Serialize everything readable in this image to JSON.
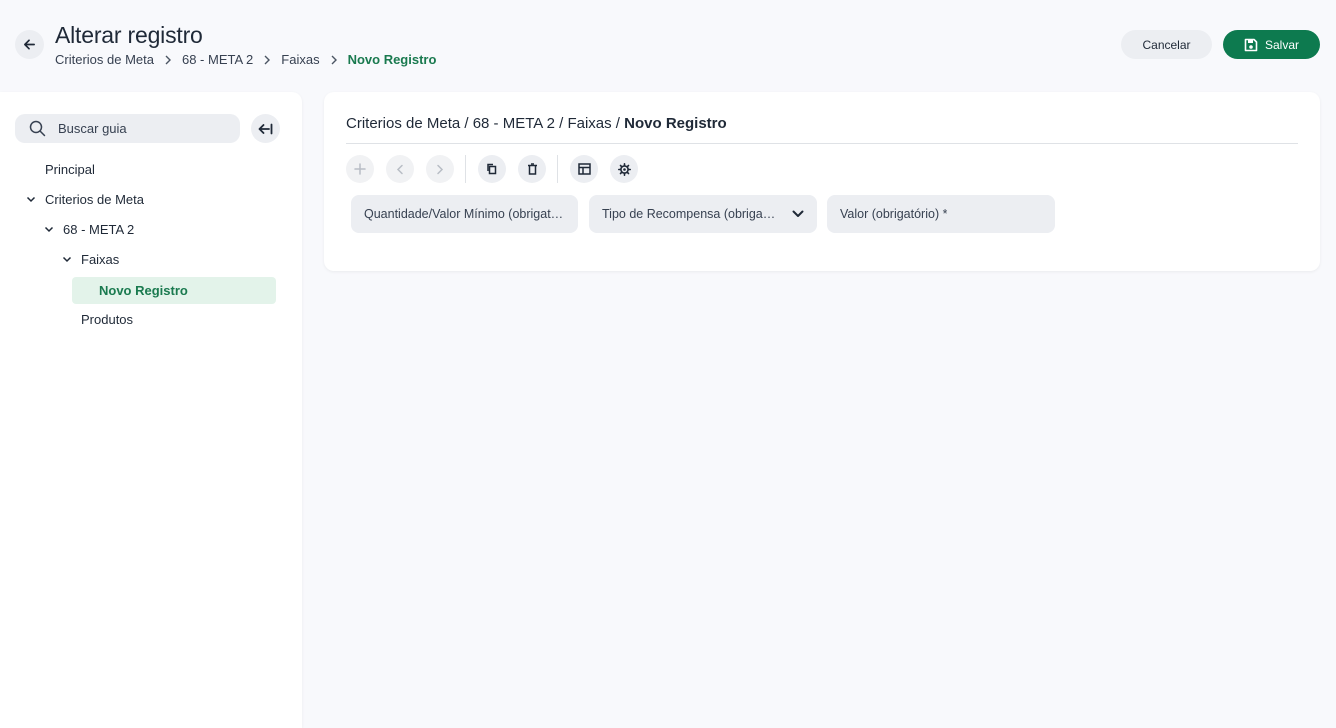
{
  "header": {
    "title": "Alterar registro",
    "breadcrumb": [
      "Criterios de Meta",
      "68 - META 2",
      "Faixas"
    ],
    "breadcrumb_current": "Novo Registro",
    "cancel_label": "Cancelar",
    "save_label": "Salvar"
  },
  "sidebar": {
    "search_placeholder": "Buscar guia",
    "items": [
      {
        "label": "Principal"
      },
      {
        "label": "Criterios de Meta"
      },
      {
        "label": "68 - META 2"
      },
      {
        "label": "Faixas"
      },
      {
        "label": "Novo Registro"
      },
      {
        "label": "Produtos"
      }
    ]
  },
  "panel": {
    "path_prefix": "Criterios de Meta / 68 - META 2 / Faixas / ",
    "path_current": "Novo Registro",
    "fields": [
      {
        "label": "Quantidade/Valor Mínimo (obrigatório) *"
      },
      {
        "label": "Tipo de Recompensa (obrigatório) *"
      },
      {
        "label": "Valor (obrigatório) *"
      }
    ]
  },
  "colors": {
    "accent": "#0d7a4f",
    "active_text": "#1a7a4f",
    "active_bg": "#e3f3ea",
    "control_bg": "#eceef2"
  },
  "icons": [
    "arrow-left-icon",
    "chevron-right-icon",
    "save-icon",
    "search-icon",
    "collapse-left-icon",
    "chevron-down-icon",
    "plus-icon",
    "chevron-left-icon",
    "copy-icon",
    "trash-icon",
    "table-icon",
    "settings-icon"
  ]
}
